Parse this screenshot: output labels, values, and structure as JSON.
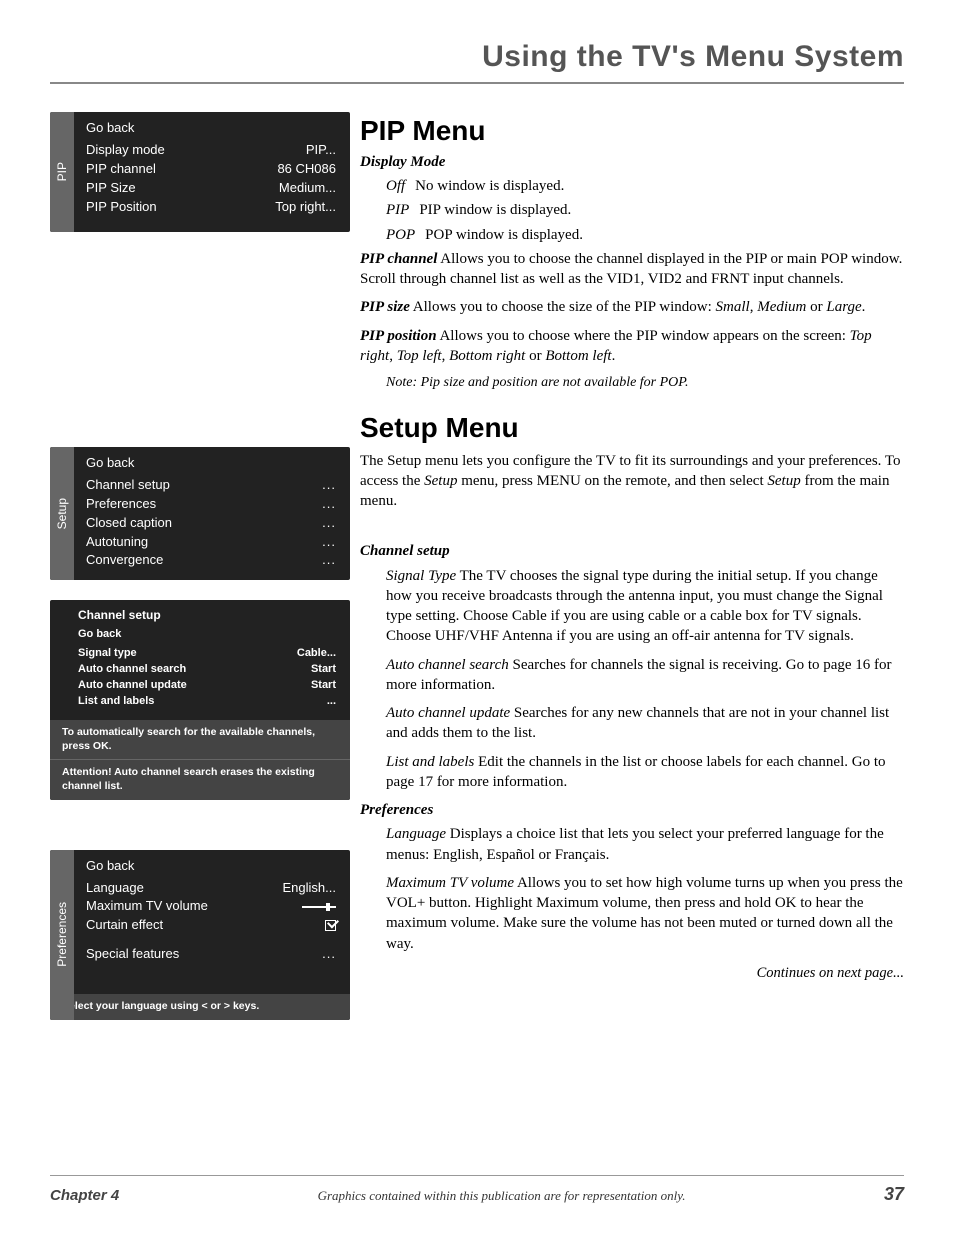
{
  "page_header": "Using the TV's Menu System",
  "pip_panel": {
    "tab": "PIP",
    "go_back": "Go back",
    "rows": [
      {
        "label": "Display mode",
        "value": "PIP..."
      },
      {
        "label": "PIP channel",
        "value": "86  CH086"
      },
      {
        "label": "PIP Size",
        "value": "Medium..."
      },
      {
        "label": "PIP Position",
        "value": "Top right..."
      }
    ]
  },
  "setup_panel": {
    "tab": "Setup",
    "go_back": "Go back",
    "rows": [
      {
        "label": "Channel setup",
        "value": "..."
      },
      {
        "label": "Preferences",
        "value": "..."
      },
      {
        "label": "Closed caption",
        "value": "..."
      },
      {
        "label": "Autotuning",
        "value": "..."
      },
      {
        "label": "Convergence",
        "value": "..."
      }
    ]
  },
  "channel_setup_panel": {
    "title": "Channel setup",
    "go_back": "Go back",
    "rows": [
      {
        "label": "Signal type",
        "value": "Cable..."
      },
      {
        "label": "Auto channel search",
        "value": "Start"
      },
      {
        "label": "Auto channel update",
        "value": "Start"
      },
      {
        "label": "List and labels",
        "value": "..."
      }
    ],
    "footer1": "To automatically search for the available channels, press OK.",
    "footer2": "Attention! Auto channel search erases the existing channel list."
  },
  "prefs_panel": {
    "tab": "Preferences",
    "go_back": "Go back",
    "rows": [
      {
        "label": "Language",
        "value": "English..."
      },
      {
        "label": "Maximum TV volume",
        "value_type": "slider"
      },
      {
        "label": "Curtain effect",
        "value_type": "checkbox"
      },
      {
        "label_spacer": true
      },
      {
        "label": "Special features",
        "value": "..."
      }
    ],
    "footer": "Select your language using < or > keys."
  },
  "pip_title": "PIP Menu",
  "display_mode_heading": "Display Mode",
  "display_mode_defs": [
    {
      "term": "Off",
      "desc": "No window is displayed."
    },
    {
      "term": "PIP",
      "desc": "PIP window is displayed."
    },
    {
      "term": "POP",
      "desc": "POP window is displayed."
    }
  ],
  "pip_channel": {
    "lead": "PIP channel",
    "text": "   Allows you to choose the channel displayed in the PIP or main POP window. Scroll through channel list as well as the VID1, VID2 and FRNT input channels."
  },
  "pip_size": {
    "lead": "PIP size",
    "pre": "   Allows you to choose the size of the PIP window: ",
    "i1": "Small",
    "c1": ", ",
    "i2": "Medium",
    "c2": " or ",
    "i3": "Large",
    "c3": "."
  },
  "pip_position": {
    "lead": "PIP position",
    "pre": "   Allows you to choose where the PIP window appears on the screen: ",
    "i1": "Top right",
    "c1": ", ",
    "i2": "Top left",
    "c2": ", ",
    "i3": "Bottom right",
    "c3": " or ",
    "i4": "Bottom left",
    "c4": "."
  },
  "pip_note": "Note: Pip size and position are not available for POP.",
  "setup_title": "Setup Menu",
  "setup_intro": {
    "p1": "The Setup menu lets you configure the TV to fit its surroundings and your preferences. To access the ",
    "i1": "Setup",
    "p2": " menu, press MENU on the remote, and then select ",
    "i2": "Setup",
    "p3": " from the main menu."
  },
  "channel_setup_heading": "Channel setup",
  "signal_type": {
    "lead": "Signal Type",
    "p1": "   The TV chooses the signal type during the initial setup. If you change how you receive broadcasts through the antenna input, you must change the ",
    "i1": "Signal type",
    "p2": " setting. Choose ",
    "i2": "Cable",
    "p3": " if you are using cable or a cable box for TV signals. Choose ",
    "i3": "UHF/VHF Antenna",
    "p4": " if you are using an off-air antenna for TV signals."
  },
  "auto_search": {
    "lead": "Auto channel search",
    "text": "   Searches for channels the signal is receiving. Go to page 16 for more information."
  },
  "auto_update": {
    "lead": "Auto channel update",
    "text": "   Searches for any new channels that are not in your channel list and adds them to the list."
  },
  "list_labels": {
    "lead": "List and labels",
    "text": "   Edit the channels in the list or choose labels for each channel. Go to page 17 for more information."
  },
  "preferences_heading": "Preferences",
  "language": {
    "lead": "Language",
    "p1": "   Displays a choice list that lets you select your preferred language for the menus: ",
    "i1": "English",
    "c1": ", ",
    "i2": "Español",
    "c2": " or ",
    "i3": "Français",
    "c3": "."
  },
  "max_volume": {
    "lead": "Maximum TV volume",
    "p1": "   Allows you to set how high volume turns up when you press the VOL+ button.  Highlight ",
    "i1": "Maximum volume",
    "p2": ", then press and hold OK to hear the maximum volume. Make sure the volume has not been muted or turned down all the way."
  },
  "continues": "Continues on next page...",
  "footer": {
    "chapter": "Chapter 4",
    "mid": "Graphics contained within this publication are for representation only.",
    "page": "37"
  }
}
